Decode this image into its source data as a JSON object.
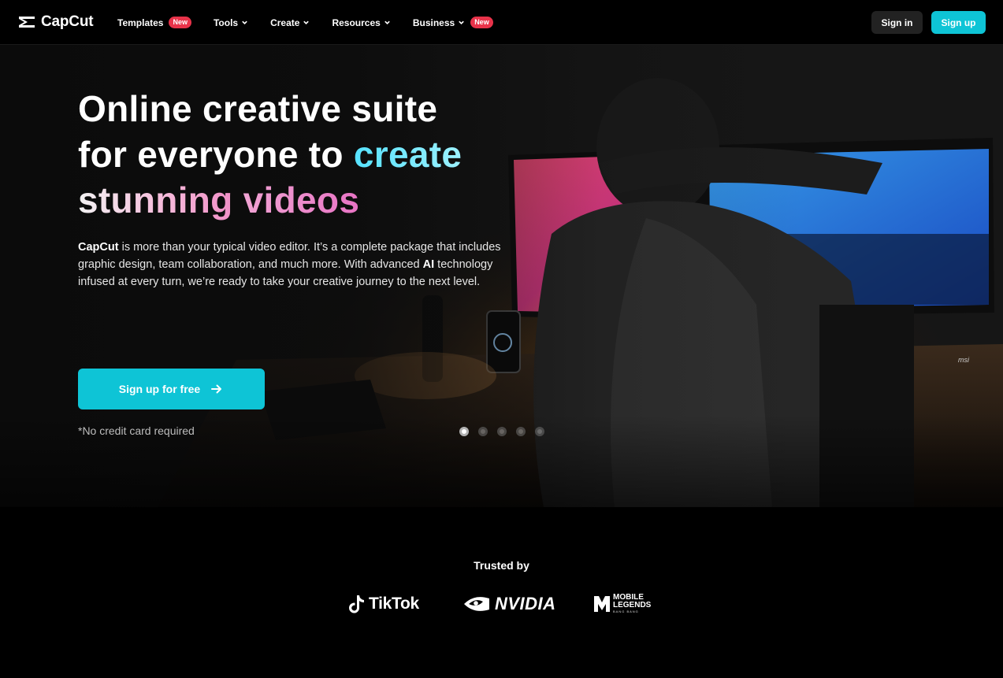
{
  "brand": {
    "name": "CapCut"
  },
  "nav": {
    "items": [
      {
        "label": "Templates",
        "has_chevron": false,
        "badge": "New"
      },
      {
        "label": "Tools",
        "has_chevron": true,
        "badge": ""
      },
      {
        "label": "Create",
        "has_chevron": true,
        "badge": ""
      },
      {
        "label": "Resources",
        "has_chevron": true,
        "badge": ""
      },
      {
        "label": "Business",
        "has_chevron": true,
        "badge": "New"
      }
    ],
    "sign_in": "Sign in",
    "sign_up": "Sign up"
  },
  "hero": {
    "headline": {
      "line1": "Online creative suite",
      "line2_prefix": "for everyone to ",
      "line2_highlight": "create",
      "line3_a": "stunning",
      "line3_b": "videos"
    },
    "desc": {
      "brand": "CapCut",
      "part1": " is more than your typical video editor. It’s a complete package that includes graphic design, team collaboration, and much more. With advanced ",
      "ai": "AI",
      "part2": " technology infused at every turn, we’re ready to take your creative journey to the next level."
    },
    "cta": "Sign up for free",
    "note": "*No credit card required",
    "carousel": {
      "count": 5,
      "active_index": 0
    },
    "monitor_brand": "msi"
  },
  "trusted": {
    "title": "Trusted by",
    "logos": [
      {
        "name": "TikTok",
        "text": "TikTok"
      },
      {
        "name": "NVIDIA",
        "text": "NVIDIA"
      },
      {
        "name": "Mobile Legends",
        "text_top": "MOBILE",
        "text_bottom": "LEGENDS",
        "sub": "BANG BANG"
      }
    ]
  },
  "colors": {
    "accent": "#0ec4d6",
    "badge": "#e8334a",
    "headline_create": "#56e2ff",
    "headline_videos": "#e873c4"
  }
}
